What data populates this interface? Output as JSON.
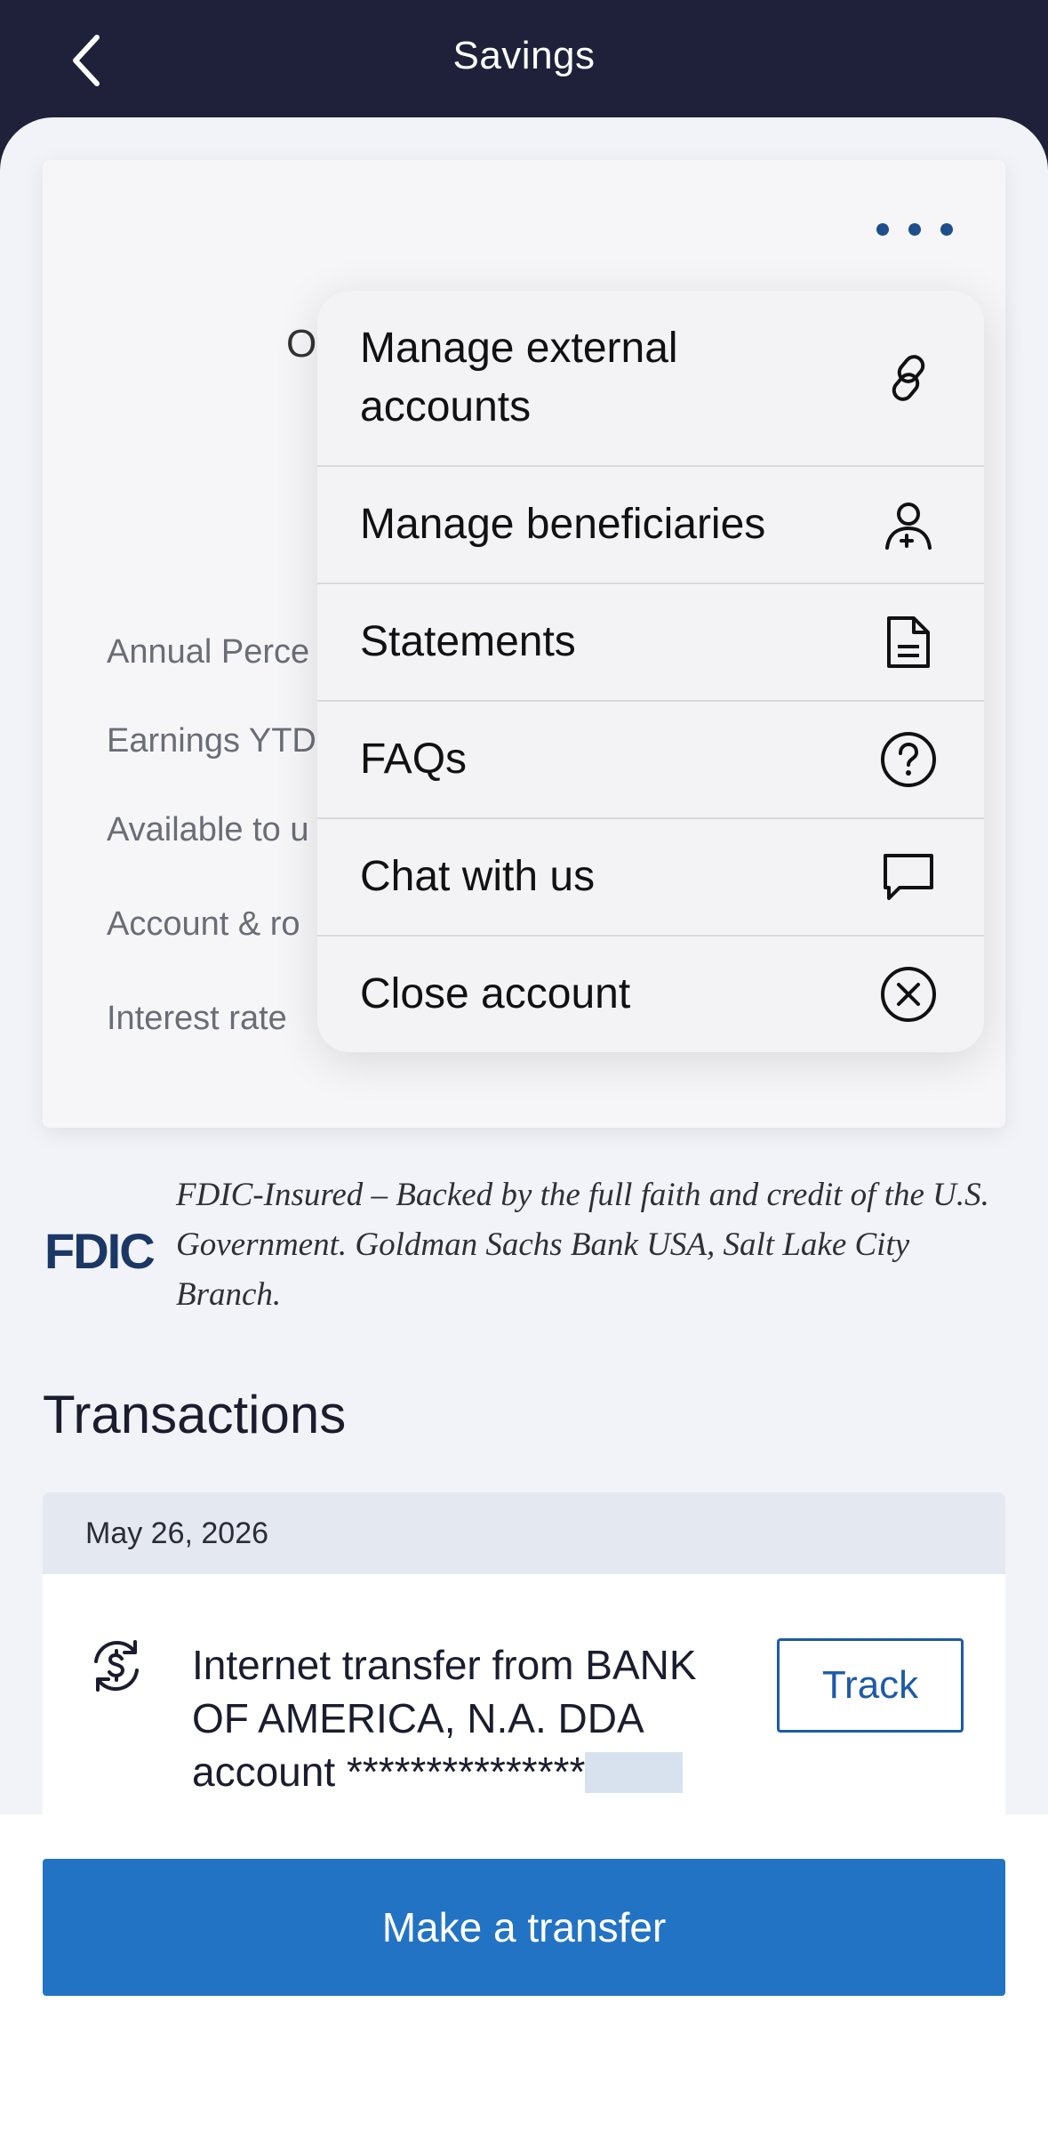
{
  "header": {
    "title": "Savings",
    "back_icon": "chevron-left-icon"
  },
  "card": {
    "heading_stub": "O",
    "details": [
      "Annual Perce",
      "Earnings YTD",
      "Available to u",
      "Account & ro",
      "Interest rate"
    ],
    "more_icon": "more-horizontal-icon"
  },
  "menu": {
    "items": [
      {
        "label": "Manage external accounts",
        "icon": "link-icon"
      },
      {
        "label": "Manage beneficiaries",
        "icon": "person-add-icon"
      },
      {
        "label": "Statements",
        "icon": "document-icon"
      },
      {
        "label": "FAQs",
        "icon": "question-circle-icon"
      },
      {
        "label": "Chat with us",
        "icon": "chat-bubble-icon"
      },
      {
        "label": "Close account",
        "icon": "close-circle-icon"
      }
    ]
  },
  "fdic": {
    "logo": "FDIC",
    "text": "FDIC-Insured – Backed by the full faith and credit of the U.S. Government. Goldman Sachs Bank USA, Salt Lake City Branch."
  },
  "transactions": {
    "title": "Transactions",
    "date": "May 26, 2026",
    "items": [
      {
        "description": "Internet transfer from BANK OF AMERICA, N.A. DDA account ***************",
        "action": "Track",
        "icon": "transfer-dollar-icon"
      }
    ]
  },
  "footer": {
    "primary_button": "Make a transfer"
  },
  "colors": {
    "header_bg": "#1e2139",
    "accent": "#2273c3",
    "link": "#1e5aa8"
  }
}
